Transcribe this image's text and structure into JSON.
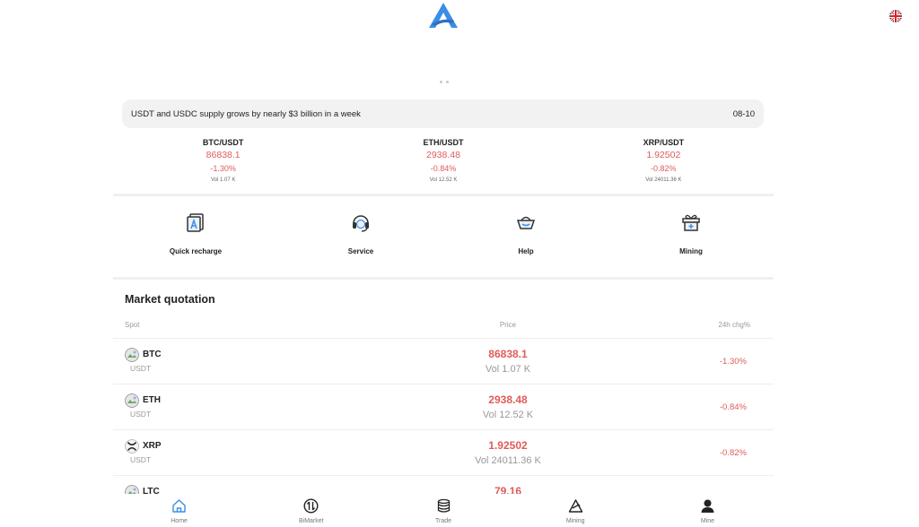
{
  "header": {
    "logo_icon": "app-logo-icon",
    "language_icon": "uk-flag-icon"
  },
  "news": {
    "headline": "USDT and USDC supply grows by nearly $3 billion in a week",
    "date": "08-10"
  },
  "tickers": [
    {
      "pair": "BTC/USDT",
      "price": "86838.1",
      "change": "-1.30%",
      "volume": "Vol 1.07 K"
    },
    {
      "pair": "ETH/USDT",
      "price": "2938.48",
      "change": "-0.84%",
      "volume": "Vol 12.52 K"
    },
    {
      "pair": "XRP/USDT",
      "price": "1.92502",
      "change": "-0.82%",
      "volume": "Vol 24011.36 K"
    }
  ],
  "quick_actions": [
    {
      "label": "Quick recharge",
      "icon": "recharge-icon"
    },
    {
      "label": "Service",
      "icon": "headset-icon"
    },
    {
      "label": "Help",
      "icon": "basket-icon"
    },
    {
      "label": "Mining",
      "icon": "gift-box-icon"
    }
  ],
  "market": {
    "title": "Market quotation",
    "columns": {
      "spot": "Spot",
      "price": "Price",
      "change": "24h chg%"
    },
    "rows": [
      {
        "coin": "BTC",
        "quote": "USDT",
        "price": "86838.1",
        "volume": "Vol 1.07 K",
        "change": "-1.30%"
      },
      {
        "coin": "ETH",
        "quote": "USDT",
        "price": "2938.48",
        "volume": "Vol 12.52 K",
        "change": "-0.84%"
      },
      {
        "coin": "XRP",
        "quote": "USDT",
        "price": "1.92502",
        "volume": "Vol 24011.36 K",
        "change": "-0.82%"
      },
      {
        "coin": "LTC",
        "quote": "",
        "price": "79.16",
        "volume": "",
        "change": ""
      }
    ]
  },
  "bottom_nav": [
    {
      "label": "Home",
      "icon": "home-icon",
      "active": true
    },
    {
      "label": "BiMarket",
      "icon": "swap-circle-icon"
    },
    {
      "label": "Trade",
      "icon": "database-icon"
    },
    {
      "label": "Mining",
      "icon": "mining-icon"
    },
    {
      "label": "Mine",
      "icon": "user-icon"
    }
  ],
  "colors": {
    "down": "#e05b5b",
    "accent": "#3a8ee6",
    "text": "#222222",
    "muted": "#999999"
  }
}
